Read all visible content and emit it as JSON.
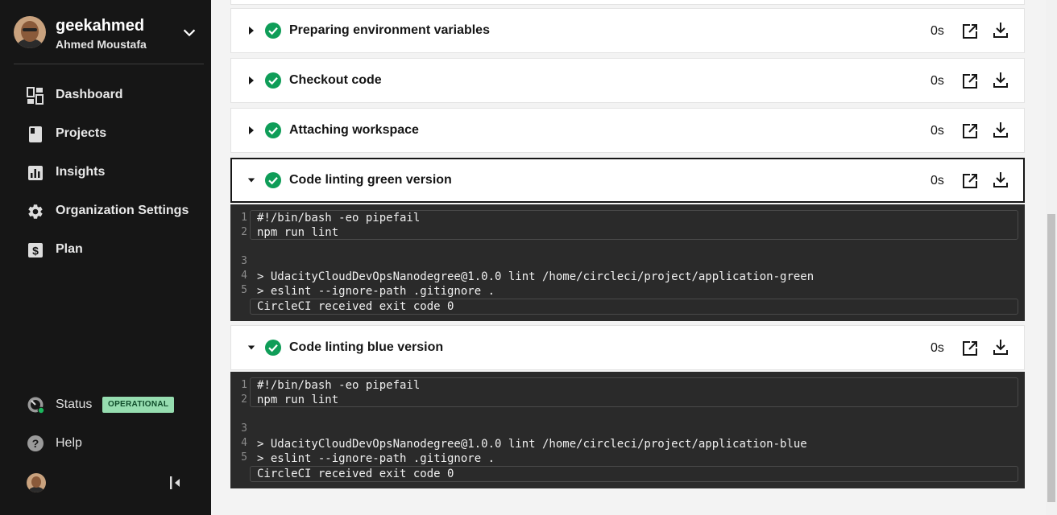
{
  "user": {
    "username": "geekahmed",
    "full_name": "Ahmed Moustafa"
  },
  "nav": [
    {
      "label": "Dashboard",
      "icon": "dashboard-icon"
    },
    {
      "label": "Projects",
      "icon": "projects-icon"
    },
    {
      "label": "Insights",
      "icon": "insights-icon"
    },
    {
      "label": "Organization Settings",
      "icon": "gear-icon"
    },
    {
      "label": "Plan",
      "icon": "plan-icon"
    }
  ],
  "status": {
    "label": "Status",
    "badge": "OPERATIONAL",
    "badge_color": "#96ddb0"
  },
  "help": {
    "label": "Help"
  },
  "steps": [
    {
      "title": "Preparing environment variables",
      "duration": "0s",
      "expanded": false,
      "status": "success"
    },
    {
      "title": "Checkout code",
      "duration": "0s",
      "expanded": false,
      "status": "success"
    },
    {
      "title": "Attaching workspace",
      "duration": "0s",
      "expanded": false,
      "status": "success"
    },
    {
      "title": "Code linting green version",
      "duration": "0s",
      "expanded": true,
      "status": "success",
      "output": {
        "lines": [
          {
            "n": "1",
            "text": "#!/bin/bash -eo pipefail"
          },
          {
            "n": "2",
            "text": "npm run lint"
          },
          {
            "n": "3",
            "text": ""
          },
          {
            "n": "4",
            "text": "> UdacityCloudDevOpsNanodegree@1.0.0 lint /home/circleci/project/application-green"
          },
          {
            "n": "5",
            "text": "> eslint --ignore-path .gitignore ."
          }
        ],
        "exit": "CircleCI received exit code 0"
      }
    },
    {
      "title": "Code linting blue version",
      "duration": "0s",
      "expanded": true,
      "status": "success",
      "output": {
        "lines": [
          {
            "n": "1",
            "text": "#!/bin/bash -eo pipefail"
          },
          {
            "n": "2",
            "text": "npm run lint"
          },
          {
            "n": "3",
            "text": ""
          },
          {
            "n": "4",
            "text": "> UdacityCloudDevOpsNanodegree@1.0.0 lint /home/circleci/project/application-blue"
          },
          {
            "n": "5",
            "text": "> eslint --ignore-path .gitignore ."
          }
        ],
        "exit": "CircleCI received exit code 0"
      }
    }
  ],
  "colors": {
    "success": "#0f9d58",
    "sidebar": "#161616",
    "terminal": "#2a2a2a"
  }
}
